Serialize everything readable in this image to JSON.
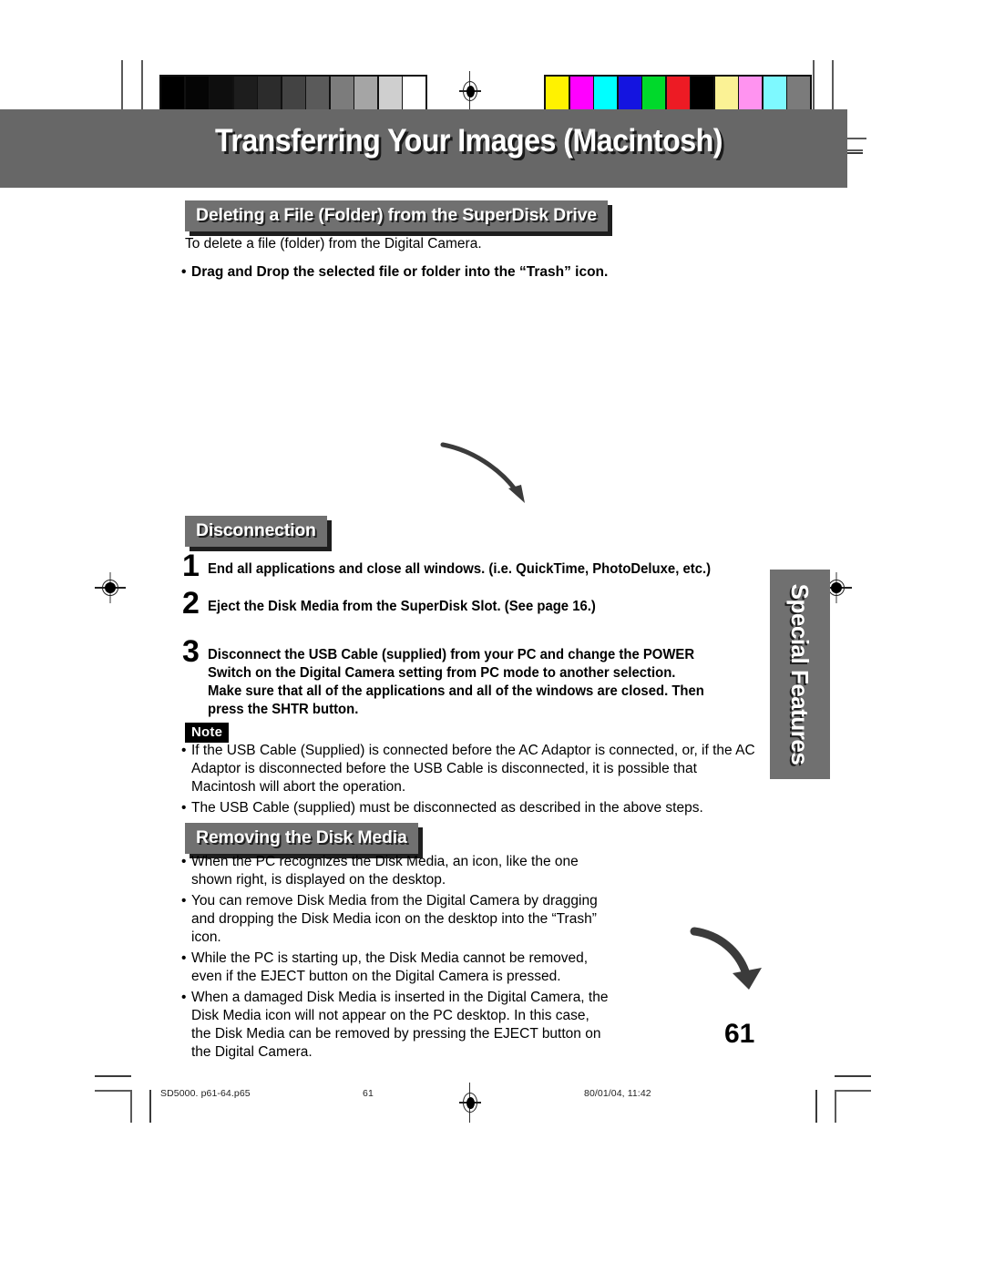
{
  "document": {
    "page_title": "Transferring Your Images (Macintosh)",
    "page_number": "61",
    "side_tab_label": "Special Features"
  },
  "sections": {
    "deleting": {
      "heading": "Deleting a File (Folder) from the SuperDisk Drive",
      "intro": "To delete a file (folder) from the Digital Camera.",
      "bullet": "Drag and Drop the selected file or folder into the “Trash” icon."
    },
    "disconnection": {
      "heading": "Disconnection",
      "steps": [
        {
          "number": "1",
          "text": "End all applications and close all windows. (i.e. QuickTime, PhotoDeluxe, etc.)"
        },
        {
          "number": "2",
          "text": "Eject the Disk Media from the SuperDisk Slot.  (See page 16.)"
        },
        {
          "number": "3",
          "text": "Disconnect  the USB Cable (supplied) from your PC and change the POWER\nSwitch on the Digital Camera setting  from PC mode to another selection.\nMake sure that all of the applications and all of the windows are closed. Then\npress the SHTR button."
        }
      ],
      "note_label": "Note",
      "note_items": [
        "If the USB Cable (Supplied) is connected before the AC Adaptor is connected, or, if the AC Adaptor is disconnected before the USB Cable is disconnected, it is possible that Macintosh will abort the operation.",
        "The USB Cable (supplied) must be disconnected as described in the above steps."
      ]
    },
    "removing": {
      "heading": "Removing the Disk Media",
      "items": [
        "When the PC recognizes the Disk Media, an icon, like the one shown right, is displayed on the desktop.",
        "You can remove Disk Media from the Digital Camera by dragging and dropping the Disk Media icon on the desktop into the “Trash” icon.",
        "While the PC is starting up, the Disk Media cannot be removed, even if the EJECT button on the Digital Camera is pressed.",
        "When a damaged Disk Media is inserted in the Digital Camera, the Disk Media icon will not appear on the PC desktop. In this case, the Disk Media can be removed by pressing the EJECT button on the Digital Camera."
      ]
    }
  },
  "footer": {
    "file_name": "SD5000. p61-64.p65",
    "page": "61",
    "timestamp": "80/01/04, 11:42"
  },
  "prepress": {
    "grayscale_swatches": [
      "#000000",
      "#050505",
      "#0e0e0e",
      "#1d1d1d",
      "#2c2c2c",
      "#434343",
      "#5a5a5a",
      "#7c7c7c",
      "#a5a5a5",
      "#cfcfcf",
      "#ffffff"
    ],
    "color_swatches": [
      "#fff200",
      "#ff00ff",
      "#00ffff",
      "#1414e0",
      "#00d92b",
      "#ed1b24",
      "#000000",
      "#fbf295",
      "#ff93f0",
      "#7ef9ff",
      "#7b7b7b"
    ],
    "banner_color": "#676767",
    "heading_color": "#707070",
    "accent_dark": "#1e1e1e"
  },
  "bullet_glyph": "•"
}
